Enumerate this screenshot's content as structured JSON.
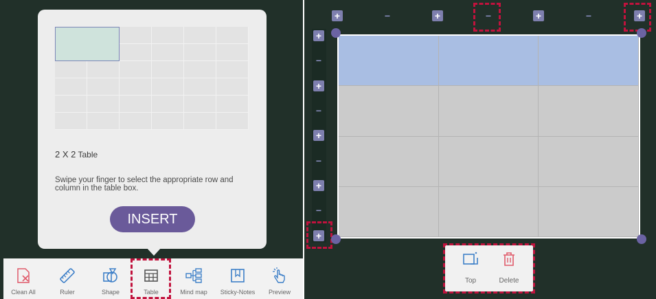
{
  "popup": {
    "table_size": "2 X 2",
    "table_word": "Table",
    "instruction": "Swipe your finger to select the appropriate row and column in the table box.",
    "insert_label": "INSERT"
  },
  "toolbar": {
    "items": [
      {
        "label": "Clean All",
        "icon": "clean-all-icon",
        "color": "#e05a6a"
      },
      {
        "label": "Ruler",
        "icon": "ruler-icon",
        "color": "#3d7fc8"
      },
      {
        "label": "Shape",
        "icon": "shape-icon",
        "color": "#3d7fc8"
      },
      {
        "label": "Table",
        "icon": "table-icon",
        "color": "#555555"
      },
      {
        "label": "Mind map",
        "icon": "mind-map-icon",
        "color": "#3d7fc8"
      },
      {
        "label": "Sticky-Notes",
        "icon": "sticky-notes-icon",
        "color": "#3d7fc8"
      },
      {
        "label": "Preview",
        "icon": "preview-icon",
        "color": "#3d7fc8"
      }
    ]
  },
  "table_controls": {
    "plus": "+",
    "minus": "−"
  },
  "context_menu": {
    "top_label": "Top",
    "delete_label": "Delete"
  },
  "colors": {
    "accent": "#6a5a9a",
    "highlight": "#c1123d",
    "background": "#213029",
    "selected_row": "#a9bee3"
  }
}
